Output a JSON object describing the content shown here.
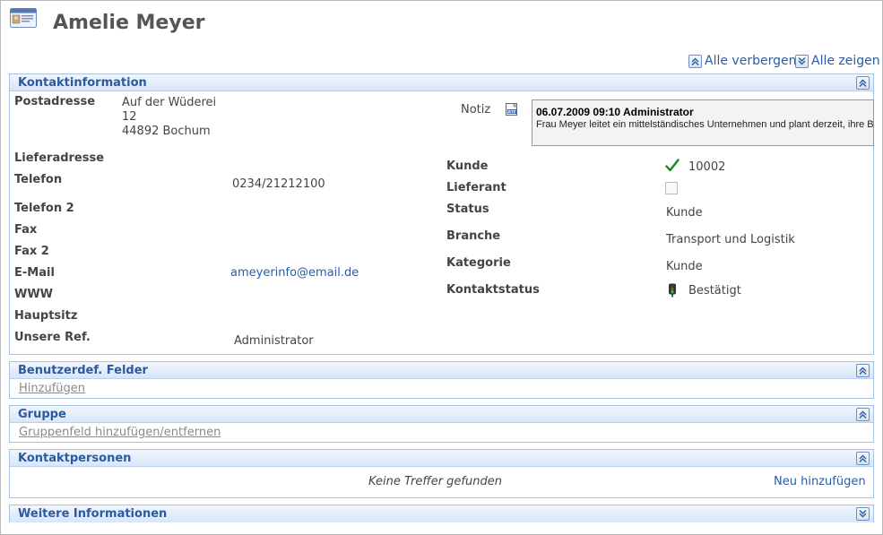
{
  "page": {
    "title": "Amelie Meyer",
    "hide_all_label": "Alle verbergen",
    "show_all_label": "Alle zeigen"
  },
  "contact_info": {
    "title": "Kontaktinformation",
    "postal_label": "Postadresse",
    "postal_line1": "Auf der Wüderei",
    "postal_line2": "12",
    "postal_line3": "44892 Bochum",
    "delivery_label": "Lieferadresse",
    "phone_label": "Telefon",
    "phone_value": "0234/21212100",
    "phone2_label": "Telefon 2",
    "fax_label": "Fax",
    "fax2_label": "Fax 2",
    "email_label": "E-Mail",
    "email_value": "ameyerinfo@email.de",
    "www_label": "WWW",
    "hq_label": "Hauptsitz",
    "ref_label": "Unsere Ref.",
    "ref_value": "Administrator",
    "note_label": "Notiz",
    "note_header": "06.07.2009 09:10 Administrator",
    "note_text": "Frau Meyer leitet ein mittelständisches Unternehmen und plant derzeit, ihre Büro",
    "customer_label": "Kunde",
    "customer_number": "10002",
    "customer_checked": true,
    "supplier_label": "Lieferant",
    "supplier_checked": false,
    "status_label": "Status",
    "status_value": "Kunde",
    "industry_label": "Branche",
    "industry_value": "Transport und Logistik",
    "category_label": "Kategorie",
    "category_value": "Kunde",
    "contact_status_label": "Kontaktstatus",
    "contact_status_value": "Bestätigt",
    "icons": {
      "card": "contact-card-icon",
      "note": "rtf-note-icon",
      "check": "checkmark-icon",
      "traffic": "traffic-light-icon",
      "collapse": "double-chevron-up-icon",
      "expand": "double-chevron-down-icon"
    },
    "colors": {
      "accent": "#2b5aa1",
      "link": "#2a5ca8",
      "check": "#1a8a1a"
    }
  },
  "custom_fields": {
    "title": "Benutzerdef. Felder",
    "add_label": "Hinzufügen"
  },
  "group": {
    "title": "Gruppe",
    "edit_label": "Gruppenfeld hinzufügen/entfernen"
  },
  "contact_persons": {
    "title": "Kontaktpersonen",
    "empty_text": "Keine Treffer gefunden",
    "add_label": "Neu hinzufügen"
  },
  "more_info": {
    "title": "Weitere Informationen"
  }
}
